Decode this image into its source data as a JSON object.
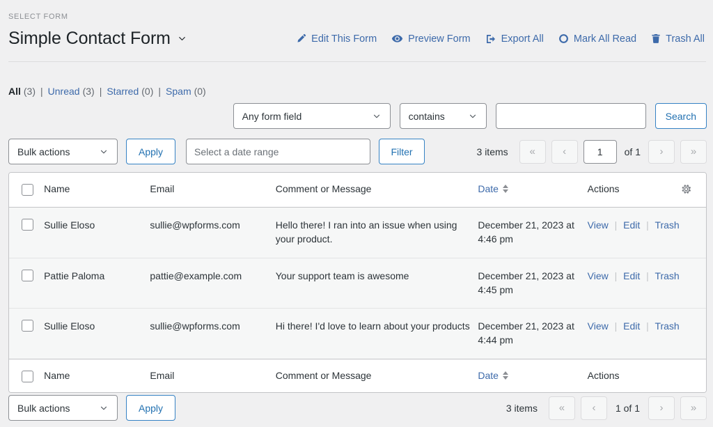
{
  "header": {
    "select_form_label": "SELECT FORM",
    "form_title": "Simple Contact Form",
    "caret_icon": "chevron-down-icon",
    "actions": [
      {
        "label": "Edit This Form",
        "icon": "pencil-icon"
      },
      {
        "label": "Preview Form",
        "icon": "eye-icon"
      },
      {
        "label": "Export All",
        "icon": "export-icon"
      },
      {
        "label": "Mark All Read",
        "icon": "circle-icon"
      },
      {
        "label": "Trash All",
        "icon": "trash-icon"
      }
    ]
  },
  "status_filters": [
    {
      "label": "All",
      "count": "(3)",
      "current": true
    },
    {
      "label": "Unread",
      "count": "(3)",
      "current": false
    },
    {
      "label": "Starred",
      "count": "(0)",
      "current": false
    },
    {
      "label": "Spam",
      "count": "(0)",
      "current": false
    }
  ],
  "status_separator": "|",
  "search": {
    "field_select": "Any form field",
    "operator_select": "contains",
    "input_value": "",
    "input_placeholder": "",
    "button_label": "Search"
  },
  "toolbar_top": {
    "bulk_actions_label": "Bulk actions",
    "apply_label": "Apply",
    "date_range_placeholder": "Select a date range",
    "date_range_value": "",
    "filter_label": "Filter"
  },
  "pagination_top": {
    "items_text": "3 items",
    "first_label": "«",
    "prev_label": "‹",
    "current_page": "1",
    "of_text": "of 1",
    "next_label": "›",
    "last_label": "»"
  },
  "toolbar_bottom": {
    "bulk_actions_label": "Bulk actions",
    "apply_label": "Apply"
  },
  "pagination_bottom": {
    "items_text": "3 items",
    "first_label": "«",
    "prev_label": "‹",
    "page_text": "1 of 1",
    "next_label": "›",
    "last_label": "»"
  },
  "table": {
    "columns": {
      "name": "Name",
      "email": "Email",
      "message": "Comment or Message",
      "date": "Date",
      "actions": "Actions"
    },
    "gear_icon": "gear-icon",
    "sort_icon": "sort-arrows-icon",
    "row_actions": {
      "view": "View",
      "edit": "Edit",
      "trash": "Trash",
      "separator": "|"
    },
    "rows": [
      {
        "name": "Sullie Eloso",
        "email": "sullie@wpforms.com",
        "message": "Hello there! I ran into an issue when using your product.",
        "date": "December 21, 2023 at 4:46 pm"
      },
      {
        "name": "Pattie Paloma",
        "email": "pattie@example.com",
        "message": "Your support team is awesome",
        "date": "December 21, 2023 at 4:45 pm"
      },
      {
        "name": "Sullie Eloso",
        "email": "sullie@wpforms.com",
        "message": "Hi there! I'd love to learn about your products",
        "date": "December 21, 2023 at 4:44 pm"
      }
    ]
  },
  "colors": {
    "link": "#3d6aaa",
    "accent": "#2271b1",
    "page_bg": "#f0f0f1",
    "row_bg": "#f6f7f7",
    "text": "#2c3338"
  }
}
